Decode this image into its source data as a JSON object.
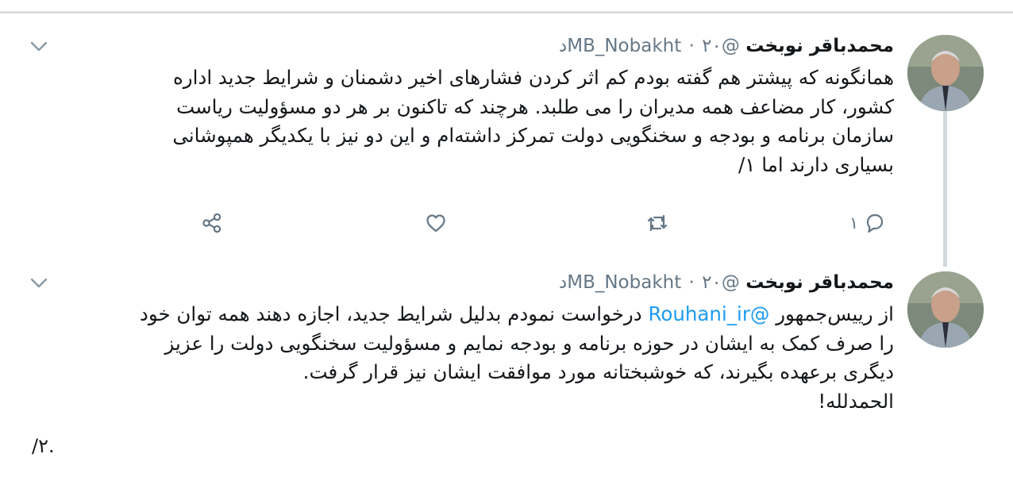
{
  "tweets": [
    {
      "name": "محمدباقر نوبخت",
      "handle": "@MB_Nobakht",
      "separator": "·",
      "time": "۲۰د",
      "lines": [
        "همانگونه که پیشتر هم گفته بودم کم اثر کردن فشارهای اخیر دشمنان و شرایط جدید اداره",
        "کشور، کار مضاعف همه مدیران را می طلبد. هرچند که تاکنون بر هر دو مسؤولیت ریاست",
        "سازمان برنامه و بودجه و سخنگویی دولت تمرکز داشته‌ام و این دو نیز با یکدیگر همپوشانی",
        "بسیاری دارند اما ۱/"
      ],
      "reply_count": "۱"
    },
    {
      "name": "محمدباقر نوبخت",
      "handle": "@MB_Nobakht",
      "separator": "·",
      "time": "۲۰د",
      "line1_before": "از رییس‌جمهور ",
      "mention": "@Rouhani_ir",
      "line1_after": " درخواست نمودم بدلیل شرایط جدید، اجازه دهند همه توان خود",
      "lines": [
        "را صرف کمک به ایشان در حوزه برنامه و بودجه نمایم و مسؤولیت سخنگویی دولت را عزیز",
        "دیگری برعهده بگیرند، که خوشبختانه مورد موافقت ایشان نیز قرار گرفت.",
        "الحمدلله!"
      ]
    }
  ],
  "footer_text": "/۲.",
  "icons": [
    "chevron-down-icon",
    "reply-icon",
    "retweet-icon",
    "like-icon",
    "share-icon"
  ]
}
